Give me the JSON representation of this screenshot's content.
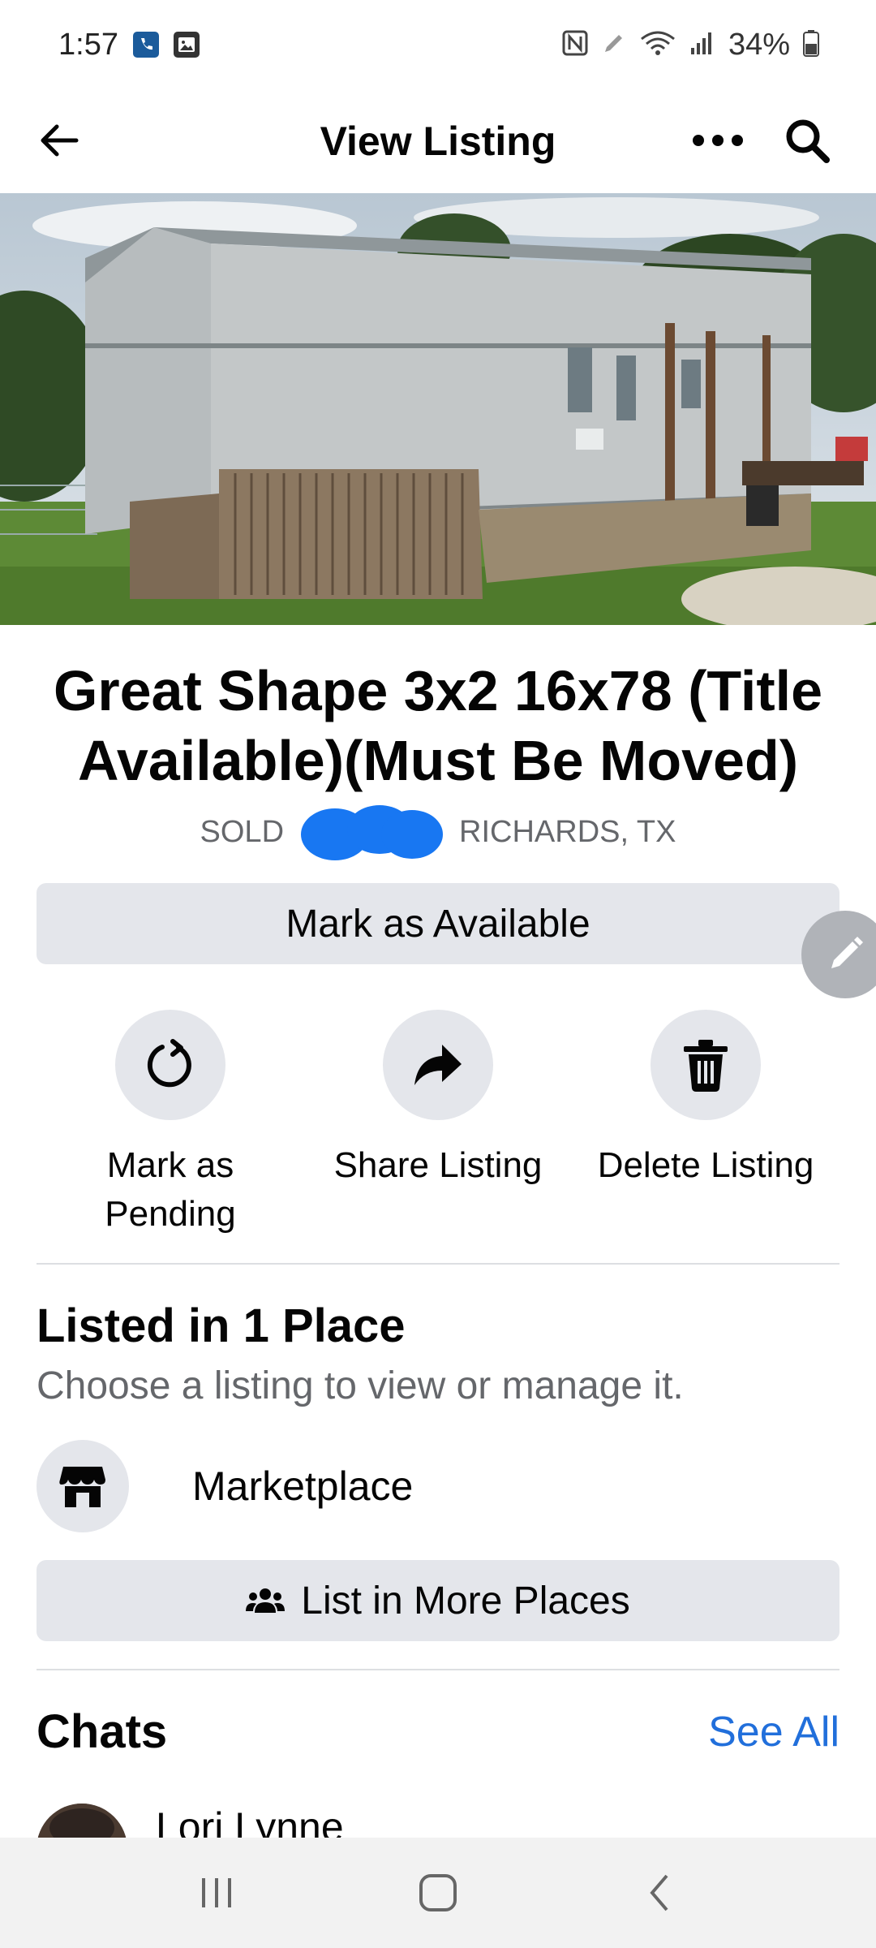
{
  "status_bar": {
    "time": "1:57",
    "battery": "34%",
    "icons": [
      "phone-app-icon",
      "gallery-icon",
      "nfc-icon",
      "pen-icon",
      "wifi-icon",
      "signal-icon",
      "battery-icon"
    ]
  },
  "header": {
    "title": "View Listing",
    "back_icon": "arrow-left-icon",
    "more_icon": "more-dots-icon",
    "search_icon": "search-icon"
  },
  "listing": {
    "title": "Great Shape 3x2 16x78 (Title Available)(Must Be Moved)",
    "status": "SOLD",
    "location": "RICHARDS, TX"
  },
  "buttons": {
    "mark_available": "Mark as Available",
    "list_more": "List in More Places"
  },
  "actions": [
    {
      "label": "Mark as Pending",
      "icon": "refresh-icon"
    },
    {
      "label": "Share Listing",
      "icon": "share-arrow-icon"
    },
    {
      "label": "Delete Listing",
      "icon": "trash-icon"
    }
  ],
  "listed": {
    "title": "Listed in 1 Place",
    "subtitle": "Choose a listing to view or manage it.",
    "places": [
      {
        "label": "Marketplace",
        "icon": "storefront-icon"
      }
    ]
  },
  "chats": {
    "title": "Chats",
    "see_all": "See All",
    "items": [
      {
        "name": "Lori Lynne"
      }
    ]
  },
  "colors": {
    "link": "#216fdb",
    "button_bg": "#e4e6eb",
    "secondary_text": "#65676b",
    "redaction": "#1877f2"
  }
}
